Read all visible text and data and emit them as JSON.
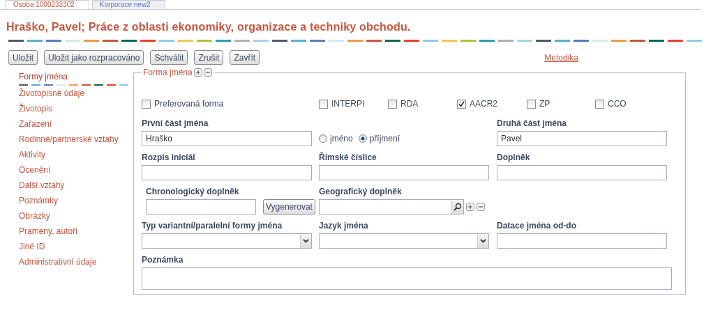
{
  "tabs": [
    {
      "label": "Osoba 1000233302",
      "selected": true
    },
    {
      "label": "Korporace new2",
      "selected": false
    }
  ],
  "title": "Hraško, Pavel; Práce z oblasti ekonomiky, organizace a techniky obchodu.",
  "toolbar": {
    "buttons": [
      "Uložit",
      "Uložit jako rozpracováno",
      "Schválit",
      "Zrušit",
      "Zavřít"
    ],
    "link": "Metodika"
  },
  "sidebar": {
    "items": [
      {
        "label": "Formy jména",
        "selected": true
      },
      {
        "label": "Životopisné údaje",
        "selected": false
      },
      {
        "label": "Životopis",
        "selected": false
      },
      {
        "label": "Zařazení",
        "selected": false
      },
      {
        "label": "Rodinné/partnerské vztahy",
        "selected": false
      },
      {
        "label": "Aktivity",
        "selected": false
      },
      {
        "label": "Ocenění",
        "selected": false
      },
      {
        "label": "Další vztahy",
        "selected": false
      },
      {
        "label": "Poznámky",
        "selected": false
      },
      {
        "label": "Obrázky",
        "selected": false
      },
      {
        "label": "Prameny, autoři",
        "selected": false
      },
      {
        "label": "Jiné ID",
        "selected": false
      },
      {
        "label": "Administrativní údaje",
        "selected": false
      }
    ]
  },
  "form": {
    "legend": "Forma jména",
    "preferred": {
      "label": "Preferovaná forma",
      "checked": false
    },
    "rules": [
      {
        "label": "INTERPI",
        "checked": false
      },
      {
        "label": "RDA",
        "checked": false
      },
      {
        "label": "AACR2",
        "checked": true
      },
      {
        "label": "ZP",
        "checked": false
      },
      {
        "label": "CCO",
        "checked": false
      }
    ],
    "first_part": {
      "label": "První část jména",
      "value": "Hraško"
    },
    "name_type": [
      {
        "label": "jméno",
        "selected": false
      },
      {
        "label": "příjmení",
        "selected": true
      }
    ],
    "second_part": {
      "label": "Druhá část jména",
      "value": "Pavel"
    },
    "initials": {
      "label": "Rozpis iniciál"
    },
    "roman": {
      "label": "Římské číslice"
    },
    "supplement": {
      "label": "Doplněk"
    },
    "chrono": {
      "label": "Chronologický doplněk",
      "button": "Vygenerovat"
    },
    "geo": {
      "label": "Geografický doplněk"
    },
    "variant_type": {
      "label": "Typ variantní/paralelní formy jména"
    },
    "language": {
      "label": "Jazyk jména"
    },
    "dating": {
      "label": "Datace jména od-do"
    },
    "note": {
      "label": "Poznámka"
    }
  }
}
